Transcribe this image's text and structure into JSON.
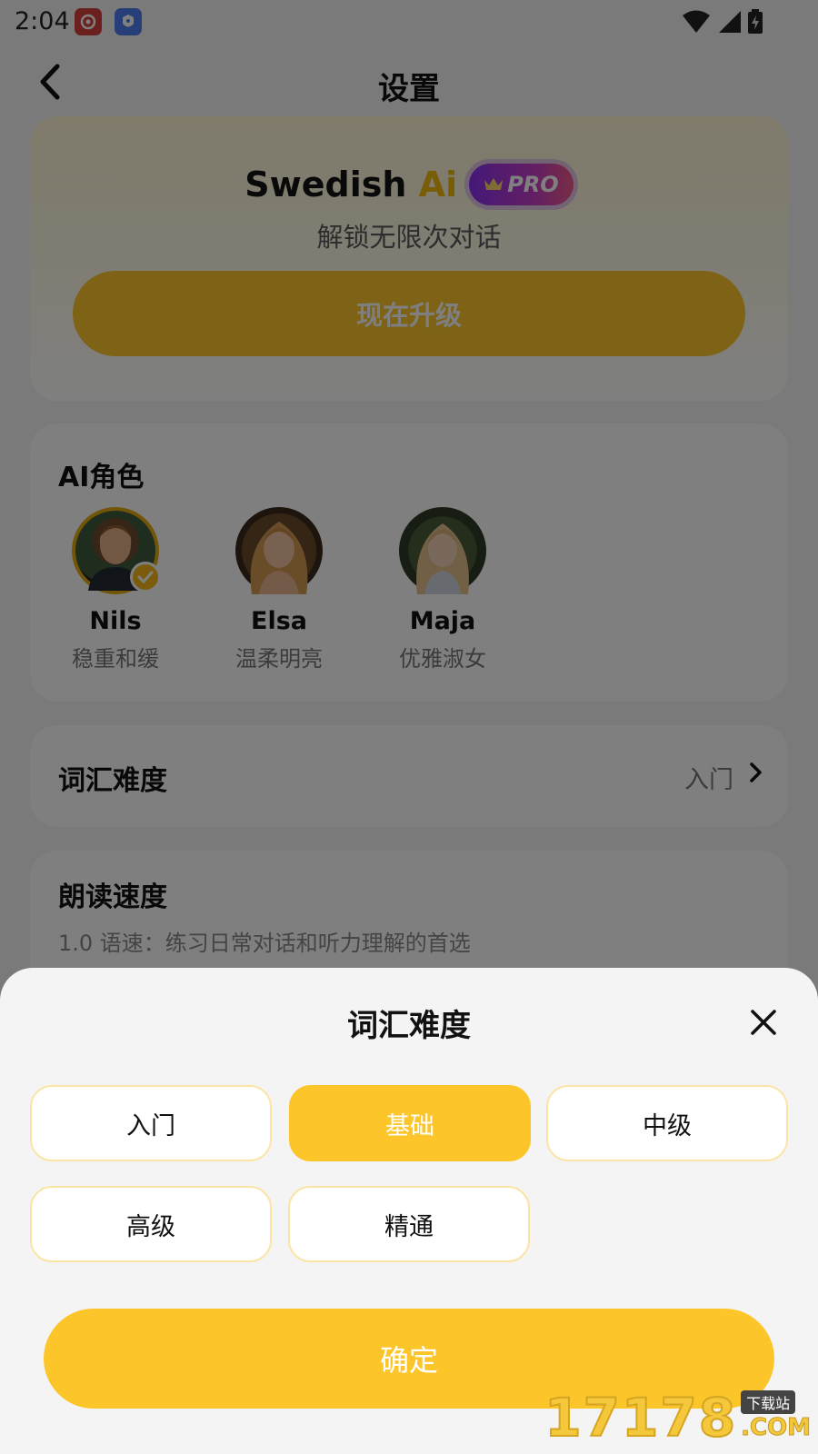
{
  "status_bar": {
    "time": "2:04"
  },
  "nav": {
    "title": "设置"
  },
  "pro_card": {
    "brand_main": "Swedish ",
    "brand_accent": "Ai",
    "badge": "PRO",
    "subtitle": "解锁无限次对话",
    "upgrade_label": "现在升级"
  },
  "ai_roles": {
    "title": "AI角色",
    "items": [
      {
        "name": "Nils",
        "desc": "稳重和缓",
        "selected": true
      },
      {
        "name": "Elsa",
        "desc": "温柔明亮",
        "selected": false
      },
      {
        "name": "Maja",
        "desc": "优雅淑女",
        "selected": false
      }
    ]
  },
  "vocab": {
    "title": "词汇难度",
    "value": "入门"
  },
  "speed": {
    "title": "朗读速度",
    "desc": "1.0 语速：练习日常对话和听力理解的首选"
  },
  "sheet": {
    "title": "词汇难度",
    "options": [
      "入门",
      "基础",
      "中级",
      "高级",
      "精通"
    ],
    "selected_index": 1,
    "confirm_label": "确定"
  },
  "watermark": {
    "digits": "17178",
    "cn": "下载站",
    "suffix": ".COM"
  },
  "colors": {
    "accent": "#fcc52a",
    "accent_dark": "#e2aa12",
    "overlay": "rgba(0,0,0,0.5)"
  }
}
